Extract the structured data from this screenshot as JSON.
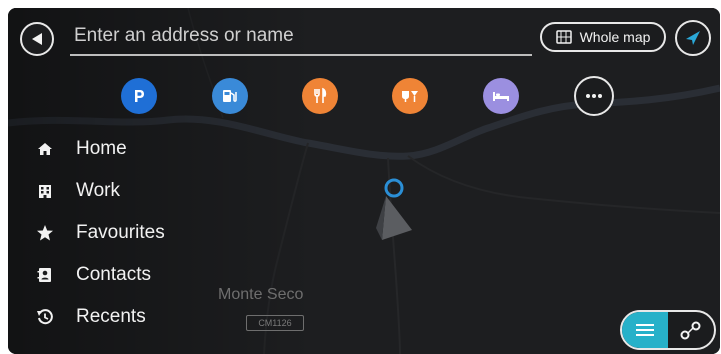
{
  "search": {
    "placeholder": "Enter an address or name"
  },
  "header": {
    "whole_map_label": "Whole map"
  },
  "categories": [
    {
      "icon": "parking-icon",
      "color": "#1f6fd6"
    },
    {
      "icon": "petrol-station-icon",
      "color": "#3a8ad8"
    },
    {
      "icon": "restaurant-icon",
      "color": "#ef8436"
    },
    {
      "icon": "bar-icon",
      "color": "#ef8436"
    },
    {
      "icon": "hotel-icon",
      "color": "#9b8fe0"
    },
    {
      "icon": "more-icon"
    }
  ],
  "menu": {
    "items": [
      {
        "label": "Home",
        "icon": "home-icon"
      },
      {
        "label": "Work",
        "icon": "work-icon"
      },
      {
        "label": "Favourites",
        "icon": "star-icon"
      },
      {
        "label": "Contacts",
        "icon": "contacts-icon"
      },
      {
        "label": "Recents",
        "icon": "recents-icon"
      }
    ]
  },
  "map": {
    "place_label": "Monte Seco",
    "road_label": "CM1126"
  },
  "colors": {
    "accent": "#27b1c9",
    "background": "#1b1c1e"
  }
}
